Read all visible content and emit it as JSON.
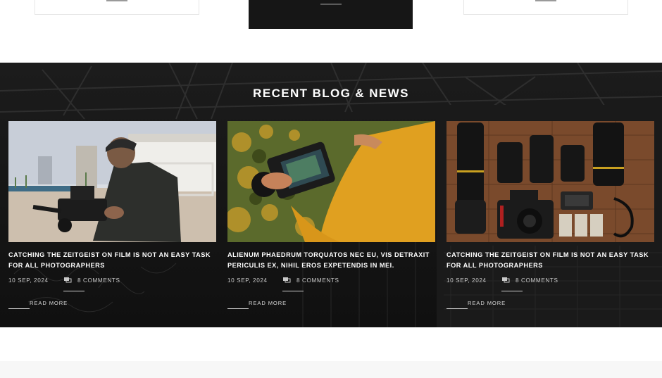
{
  "section": {
    "title": "RECENT BLOG & NEWS"
  },
  "posts": [
    {
      "title": "CATCHING THE ZEITGEIST ON FILM IS NOT AN EASY TASK FOR ALL PHOTOGRAPHERS",
      "date": "10 SEP, 2024",
      "comments": "8 COMMENTS",
      "read_more": "READ MORE",
      "image": "photographer-with-video-camera-on-beach"
    },
    {
      "title": "ALIENUM PHAEDRUM TORQUATOS NEC EU, VIS DETRAXIT PERICULIS EX, NIHIL EROS EXPETENDIS IN MEI.",
      "date": "10 SEP, 2024",
      "comments": "8 COMMENTS",
      "read_more": "READ MORE",
      "image": "hands-holding-cinema-camera-yellow-jacket"
    },
    {
      "title": "CATCHING THE ZEITGEIST ON FILM IS NOT AN EASY TASK FOR ALL PHOTOGRAPHERS",
      "date": "10 SEP, 2024",
      "comments": "8 COMMENTS",
      "read_more": "READ MORE",
      "image": "camera-lenses-flatlay-on-wood"
    }
  ],
  "icons": {
    "comments": "comment-bubbles-icon"
  },
  "colors": {
    "section_bg": "#141414",
    "text": "#ffffff",
    "muted": "#c9c9c9",
    "accent_yellow": "#e0a020"
  }
}
